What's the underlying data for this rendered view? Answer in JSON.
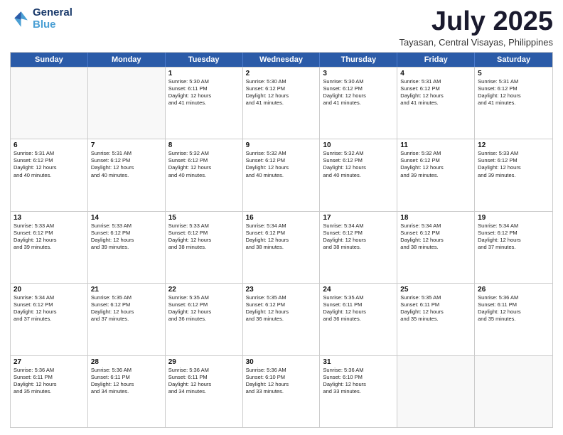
{
  "header": {
    "logo_line1": "General",
    "logo_line2": "Blue",
    "month_title": "July 2025",
    "location": "Tayasan, Central Visayas, Philippines"
  },
  "days": [
    "Sunday",
    "Monday",
    "Tuesday",
    "Wednesday",
    "Thursday",
    "Friday",
    "Saturday"
  ],
  "weeks": [
    [
      {
        "day": "",
        "text": ""
      },
      {
        "day": "",
        "text": ""
      },
      {
        "day": "1",
        "text": "Sunrise: 5:30 AM\nSunset: 6:11 PM\nDaylight: 12 hours\nand 41 minutes."
      },
      {
        "day": "2",
        "text": "Sunrise: 5:30 AM\nSunset: 6:12 PM\nDaylight: 12 hours\nand 41 minutes."
      },
      {
        "day": "3",
        "text": "Sunrise: 5:30 AM\nSunset: 6:12 PM\nDaylight: 12 hours\nand 41 minutes."
      },
      {
        "day": "4",
        "text": "Sunrise: 5:31 AM\nSunset: 6:12 PM\nDaylight: 12 hours\nand 41 minutes."
      },
      {
        "day": "5",
        "text": "Sunrise: 5:31 AM\nSunset: 6:12 PM\nDaylight: 12 hours\nand 41 minutes."
      }
    ],
    [
      {
        "day": "6",
        "text": "Sunrise: 5:31 AM\nSunset: 6:12 PM\nDaylight: 12 hours\nand 40 minutes."
      },
      {
        "day": "7",
        "text": "Sunrise: 5:31 AM\nSunset: 6:12 PM\nDaylight: 12 hours\nand 40 minutes."
      },
      {
        "day": "8",
        "text": "Sunrise: 5:32 AM\nSunset: 6:12 PM\nDaylight: 12 hours\nand 40 minutes."
      },
      {
        "day": "9",
        "text": "Sunrise: 5:32 AM\nSunset: 6:12 PM\nDaylight: 12 hours\nand 40 minutes."
      },
      {
        "day": "10",
        "text": "Sunrise: 5:32 AM\nSunset: 6:12 PM\nDaylight: 12 hours\nand 40 minutes."
      },
      {
        "day": "11",
        "text": "Sunrise: 5:32 AM\nSunset: 6:12 PM\nDaylight: 12 hours\nand 39 minutes."
      },
      {
        "day": "12",
        "text": "Sunrise: 5:33 AM\nSunset: 6:12 PM\nDaylight: 12 hours\nand 39 minutes."
      }
    ],
    [
      {
        "day": "13",
        "text": "Sunrise: 5:33 AM\nSunset: 6:12 PM\nDaylight: 12 hours\nand 39 minutes."
      },
      {
        "day": "14",
        "text": "Sunrise: 5:33 AM\nSunset: 6:12 PM\nDaylight: 12 hours\nand 39 minutes."
      },
      {
        "day": "15",
        "text": "Sunrise: 5:33 AM\nSunset: 6:12 PM\nDaylight: 12 hours\nand 38 minutes."
      },
      {
        "day": "16",
        "text": "Sunrise: 5:34 AM\nSunset: 6:12 PM\nDaylight: 12 hours\nand 38 minutes."
      },
      {
        "day": "17",
        "text": "Sunrise: 5:34 AM\nSunset: 6:12 PM\nDaylight: 12 hours\nand 38 minutes."
      },
      {
        "day": "18",
        "text": "Sunrise: 5:34 AM\nSunset: 6:12 PM\nDaylight: 12 hours\nand 38 minutes."
      },
      {
        "day": "19",
        "text": "Sunrise: 5:34 AM\nSunset: 6:12 PM\nDaylight: 12 hours\nand 37 minutes."
      }
    ],
    [
      {
        "day": "20",
        "text": "Sunrise: 5:34 AM\nSunset: 6:12 PM\nDaylight: 12 hours\nand 37 minutes."
      },
      {
        "day": "21",
        "text": "Sunrise: 5:35 AM\nSunset: 6:12 PM\nDaylight: 12 hours\nand 37 minutes."
      },
      {
        "day": "22",
        "text": "Sunrise: 5:35 AM\nSunset: 6:12 PM\nDaylight: 12 hours\nand 36 minutes."
      },
      {
        "day": "23",
        "text": "Sunrise: 5:35 AM\nSunset: 6:12 PM\nDaylight: 12 hours\nand 36 minutes."
      },
      {
        "day": "24",
        "text": "Sunrise: 5:35 AM\nSunset: 6:11 PM\nDaylight: 12 hours\nand 36 minutes."
      },
      {
        "day": "25",
        "text": "Sunrise: 5:35 AM\nSunset: 6:11 PM\nDaylight: 12 hours\nand 35 minutes."
      },
      {
        "day": "26",
        "text": "Sunrise: 5:36 AM\nSunset: 6:11 PM\nDaylight: 12 hours\nand 35 minutes."
      }
    ],
    [
      {
        "day": "27",
        "text": "Sunrise: 5:36 AM\nSunset: 6:11 PM\nDaylight: 12 hours\nand 35 minutes."
      },
      {
        "day": "28",
        "text": "Sunrise: 5:36 AM\nSunset: 6:11 PM\nDaylight: 12 hours\nand 34 minutes."
      },
      {
        "day": "29",
        "text": "Sunrise: 5:36 AM\nSunset: 6:11 PM\nDaylight: 12 hours\nand 34 minutes."
      },
      {
        "day": "30",
        "text": "Sunrise: 5:36 AM\nSunset: 6:10 PM\nDaylight: 12 hours\nand 33 minutes."
      },
      {
        "day": "31",
        "text": "Sunrise: 5:36 AM\nSunset: 6:10 PM\nDaylight: 12 hours\nand 33 minutes."
      },
      {
        "day": "",
        "text": ""
      },
      {
        "day": "",
        "text": ""
      }
    ]
  ]
}
